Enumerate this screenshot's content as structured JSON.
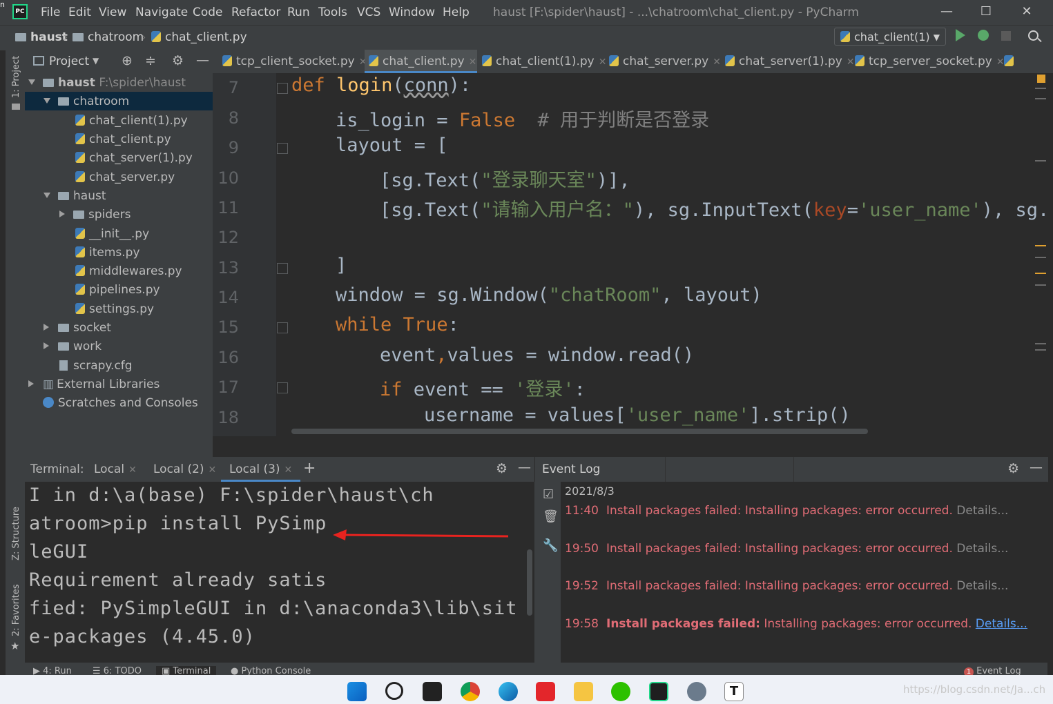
{
  "app": {
    "logo_text": "PC",
    "window_title": "haust [F:\\spider\\haust] - ...\\chatroom\\chat_client.py - PyCharm",
    "menu": [
      "File",
      "Edit",
      "View",
      "Navigate",
      "Code",
      "Refactor",
      "Run",
      "Tools",
      "VCS",
      "Window",
      "Help"
    ],
    "window_controls": [
      "—",
      "☐",
      "✕"
    ]
  },
  "breadcrumb": [
    "haust",
    "chatroom",
    "chat_client.py"
  ],
  "run_config": "chat_client(1)",
  "project_panel": {
    "title": "Project",
    "root_name": "haust",
    "root_path": "F:\\spider\\haust",
    "items": [
      {
        "label": "chatroom"
      },
      {
        "label": "chat_client(1).py"
      },
      {
        "label": "chat_client.py"
      },
      {
        "label": "chat_server(1).py"
      },
      {
        "label": "chat_server.py"
      },
      {
        "label": "haust"
      },
      {
        "label": "spiders"
      },
      {
        "label": "__init__.py"
      },
      {
        "label": "items.py"
      },
      {
        "label": "middlewares.py"
      },
      {
        "label": "pipelines.py"
      },
      {
        "label": "settings.py"
      },
      {
        "label": "socket"
      },
      {
        "label": "work"
      },
      {
        "label": "scrapy.cfg"
      },
      {
        "label": "External Libraries"
      },
      {
        "label": "Scratches and Consoles"
      }
    ]
  },
  "left_strip": {
    "project": "1: Project",
    "structure": "Z: Structure",
    "favorites": "2: Favorites"
  },
  "editor_tabs": [
    "tcp_client_socket.py",
    "chat_client.py",
    "chat_client(1).py",
    "chat_server.py",
    "chat_server(1).py",
    "tcp_server_socket.py"
  ],
  "editor": {
    "line_numbers": [
      "7",
      "8",
      "9",
      "10",
      "11",
      "12",
      "13",
      "14",
      "15",
      "16",
      "17",
      "18"
    ]
  },
  "terminal": {
    "label": "Terminal:",
    "tabs": [
      "Local",
      "Local (2)",
      "Local (3)"
    ],
    "add": "+",
    "lines": [
      "I in d:\\a(base) F:\\spider\\haust\\ch",
      "atroom>pip install PySimp",
      "leGUI",
      "Requirement already satis",
      "fied: PySimpleGUI in d:\\anaconda3\\lib\\sit",
      "e-packages (4.45.0)"
    ]
  },
  "event_log": {
    "title": "Event Log",
    "date": "2021/8/3",
    "entries": [
      {
        "time": "11:40",
        "message": "Install packages failed: Installing packages: error occurred.",
        "link": "Details..."
      },
      {
        "time": "19:50",
        "message": "Install packages failed: Installing packages: error occurred.",
        "link": "Details..."
      },
      {
        "time": "19:52",
        "message": "Install packages failed: Installing packages: error occurred.",
        "link": "Details..."
      },
      {
        "time": "19:58",
        "bold": "Install packages failed:",
        "message": " Installing packages: error occurred.",
        "link": "Details..."
      }
    ]
  },
  "bottom_tools": [
    "4: Run",
    "6: TODO",
    "Terminal",
    "Python Console",
    "Event Log"
  ],
  "event_log_badge": "1",
  "watermark": "https://blog.csdn.net/Ja...ch",
  "colors": {
    "accent": "#4a88c7",
    "error": "#e06c75",
    "keyword": "#cc7832",
    "string": "#6a8759",
    "function": "#ffc66d",
    "annotation_arrow": "#e8231f"
  }
}
